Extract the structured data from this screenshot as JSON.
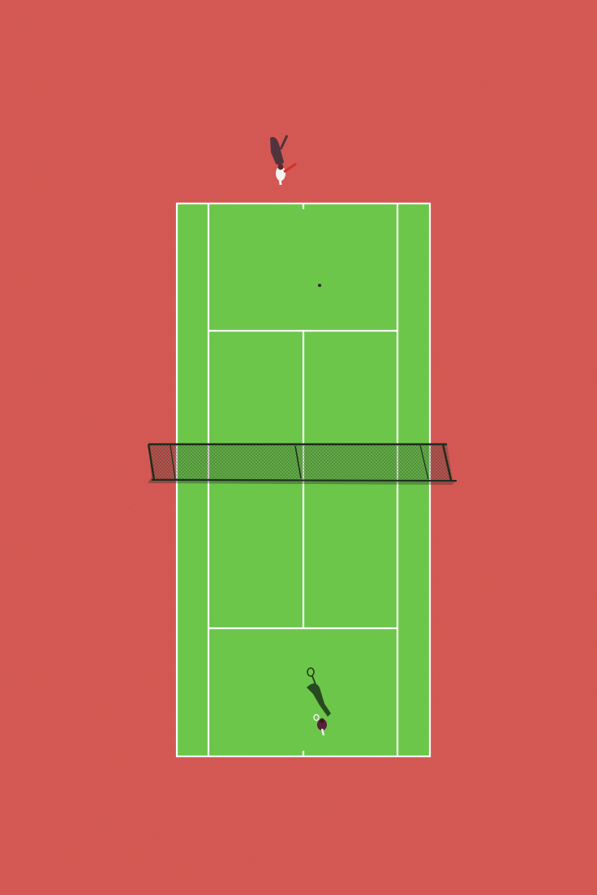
{
  "scene": {
    "description_free": true,
    "colors": {
      "surround": "#d4544f",
      "surround_light": "#dc5e58",
      "court": "#6cc64a",
      "court_shade": "#64bd44",
      "lines": "#ffffff",
      "net": "#1f2a1f",
      "net_mesh": "#2d3a2b",
      "player_top_outfit": "#f2f2f2",
      "player_top_racket": "#d0312d",
      "player_shadow": "#3a2d3a",
      "player_bottom_shadow": "#1f3d1c",
      "player_bottom_outfit": "#5a2040"
    },
    "icons": {
      "top_player": "tennis-player-icon",
      "bottom_player": "tennis-player-icon",
      "ball": "tennis-ball-icon"
    }
  }
}
